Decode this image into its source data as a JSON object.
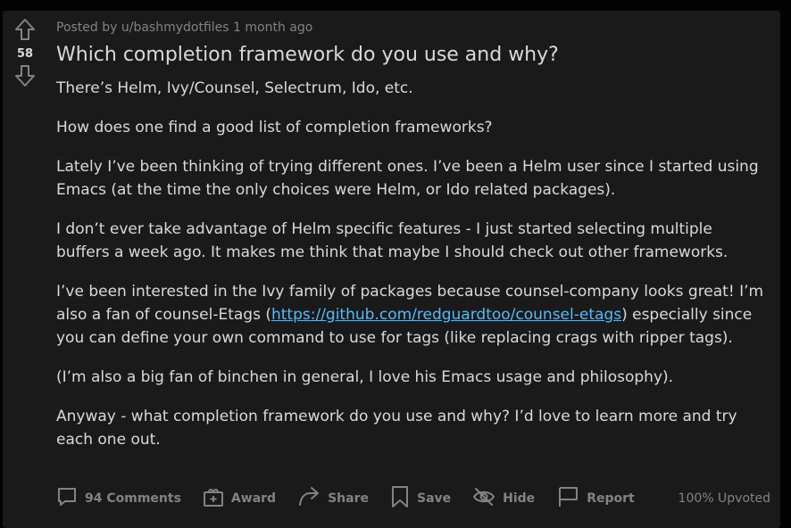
{
  "post": {
    "score": "58",
    "meta_prefix": "Posted by",
    "author": "u/bashmydotfiles",
    "time": "1 month ago",
    "title": "Which completion framework do you use and why?",
    "paragraphs": [
      "There’s Helm, Ivy/Counsel, Selectrum, Ido, etc.",
      "How does one find a good list of completion frameworks?",
      "Lately I’ve been thinking of trying different ones. I’ve been a Helm user since I started using Emacs (at the time the only choices were Helm, or Ido related packages).",
      "I don’t ever take advantage of Helm specific features - I just started selecting multiple buffers a week ago. It makes me think that maybe I should check out other frameworks."
    ],
    "p5_before": "I’ve been interested in the Ivy family of packages because counsel-company looks great! I’m also a fan of counsel-Etags (",
    "p5_link": "https://github.com/redguardtoo/counsel-etags",
    "p5_after": ") especially since you can define your own command to use for tags (like replacing crags with ripper tags).",
    "p6": "(I’m also a big fan of binchen in general, I love his Emacs usage and philosophy).",
    "p7": "Anyway - what completion framework do you use and why? I’d love to learn more and try each one out."
  },
  "actions": {
    "comments": "94 Comments",
    "award": "Award",
    "share": "Share",
    "save": "Save",
    "hide": "Hide",
    "report": "Report",
    "upvoted": "100% Upvoted"
  },
  "icons": [
    "upvote-icon",
    "downvote-icon",
    "comment-icon",
    "award-icon",
    "share-icon",
    "save-icon",
    "hide-icon",
    "report-icon"
  ],
  "colors": {
    "background": "#030303",
    "card": "#1a1a1b",
    "text": "#d7dadc",
    "muted": "#818384",
    "link": "#4fbcff"
  }
}
